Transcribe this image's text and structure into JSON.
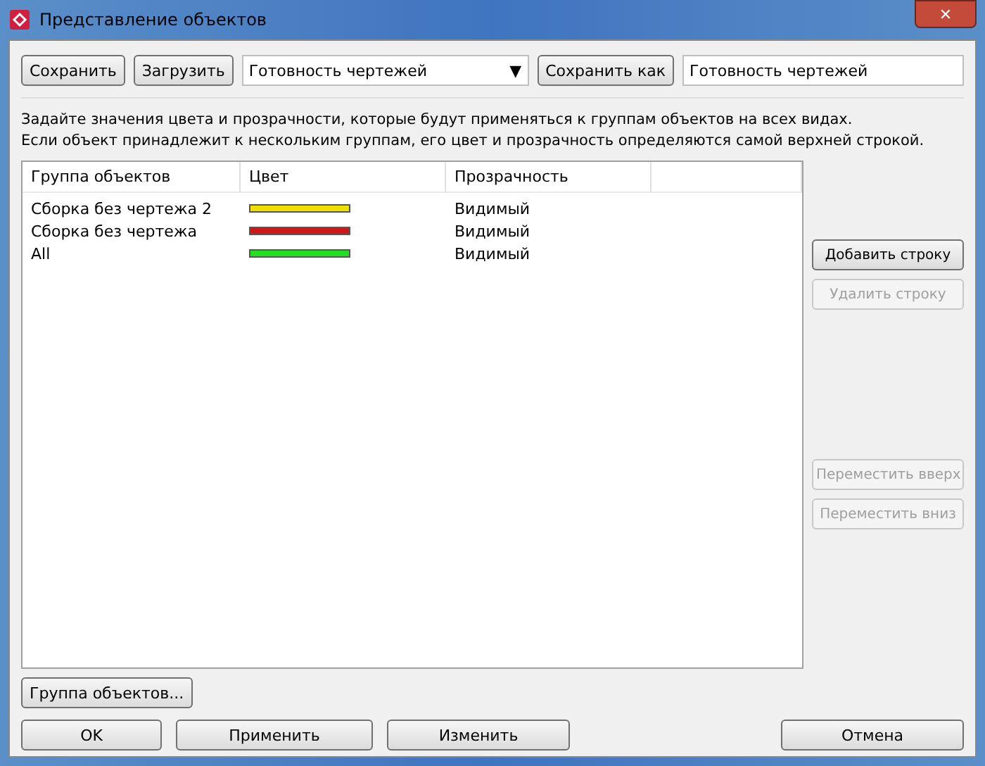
{
  "window": {
    "title": "Представление объектов",
    "close": "✕"
  },
  "toolbar": {
    "save": "Сохранить",
    "load": "Загрузить",
    "preset": "Готовность чертежей",
    "dropdown_arrow": "▼",
    "save_as": "Сохранить как",
    "save_as_name": "Готовность чертежей"
  },
  "instructions": [
    "Задайте значения цвета и прозрачности, которые будут применяться к группам объектов на всех видах.",
    "Если объект принадлежит к нескольким группам, его цвет и прозрачность определяются самой верхней строкой."
  ],
  "table": {
    "columns": [
      "Группа объектов",
      "Цвет",
      "Прозрачность"
    ],
    "rows": [
      {
        "group": "Сборка без чертежа 2",
        "color": "#f0e000",
        "transparency": "Видимый"
      },
      {
        "group": "Сборка без чертежа",
        "color": "#d01818",
        "transparency": "Видимый"
      },
      {
        "group": "All",
        "color": "#20e020",
        "transparency": "Видимый"
      }
    ]
  },
  "side_buttons": [
    {
      "label": "Добавить строку",
      "disabled": false
    },
    {
      "label": "Удалить строку",
      "disabled": true
    },
    {
      "label": "Переместить вверх",
      "disabled": true
    },
    {
      "label": "Переместить вниз",
      "disabled": true
    }
  ],
  "group_button": "Группа объектов...",
  "footer_buttons": [
    "OK",
    "Применить",
    "Изменить",
    "Отмена"
  ]
}
